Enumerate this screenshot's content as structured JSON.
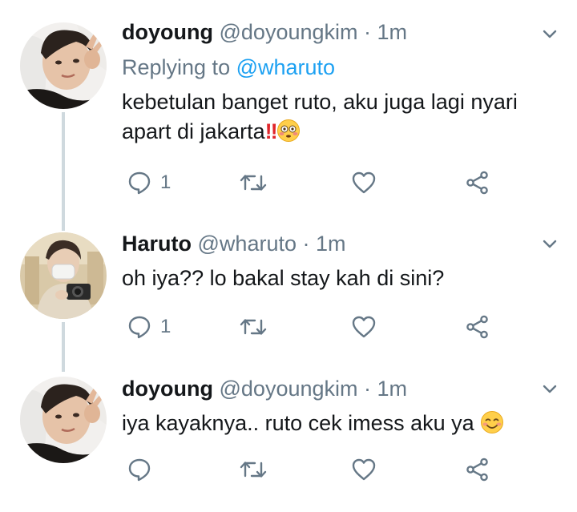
{
  "tweets": [
    {
      "name": "doyoung",
      "handle": "@doyoungkim",
      "separator": "·",
      "time": "1m",
      "replying_prefix": "Replying to",
      "replying_to": "@wharuto",
      "text_line1": "kebetulan banget ruto, aku juga lagi nyari",
      "text_line2": "apart di jakarta",
      "text_emoji": [
        "double-exclamation-emoji",
        "flushed-face-emoji"
      ],
      "reply_count": "1",
      "avatar": "doyoung-avatar"
    },
    {
      "name": "Haruto",
      "handle": "@wharuto",
      "separator": "·",
      "time": "1m",
      "text_line1": "oh iya?? lo bakal stay kah di sini?",
      "reply_count": "1",
      "avatar": "haruto-avatar"
    },
    {
      "name": "doyoung",
      "handle": "@doyoungkim",
      "separator": "·",
      "time": "1m",
      "text_line1": "iya kayaknya.. ruto cek imess aku ya",
      "text_emoji": [
        "smiling-face-emoji"
      ],
      "reply_count": "",
      "avatar": "doyoung-avatar"
    }
  ],
  "icons": {
    "reply": "reply-icon",
    "retweet": "retweet-icon",
    "like": "heart-icon",
    "share": "share-icon",
    "menu": "chevron-down-icon"
  },
  "colors": {
    "text": "#14171a",
    "secondary": "#657786",
    "link": "#1da1f2",
    "thread_line": "#cfd9de",
    "bang": "#e0262b"
  }
}
